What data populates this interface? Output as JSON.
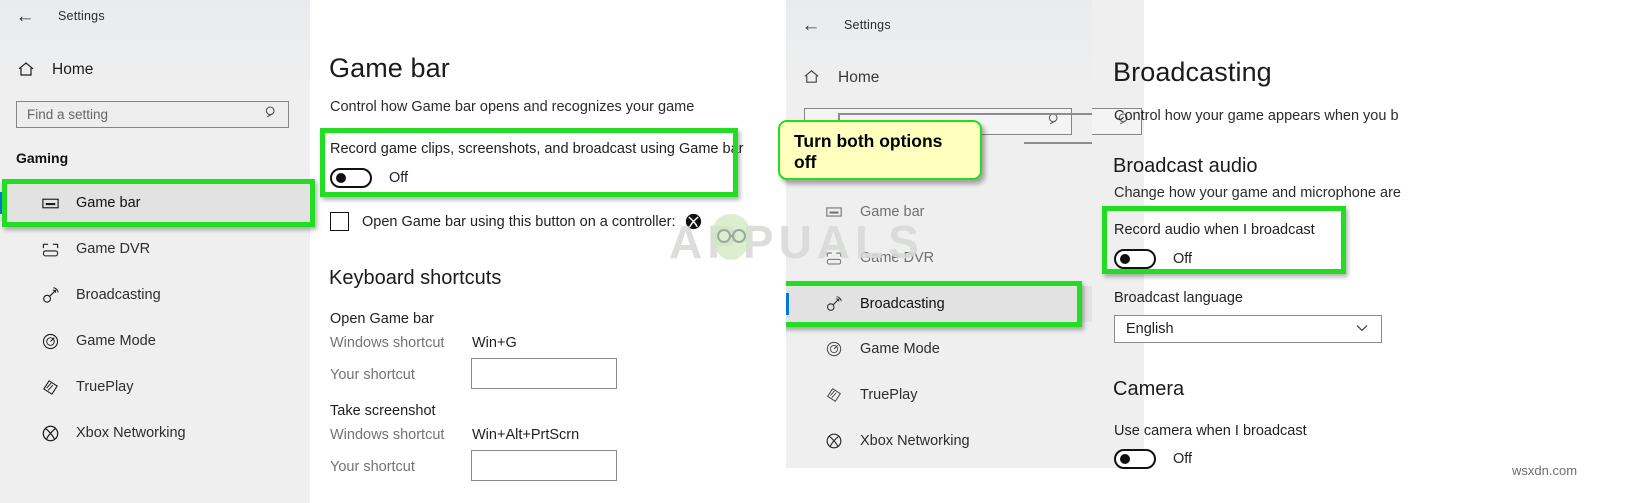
{
  "panel1": {
    "titlebar": {
      "back_icon": "back-arrow-icon",
      "title": "Settings"
    },
    "home": {
      "icon": "home-icon",
      "label": "Home"
    },
    "search": {
      "placeholder": "Find a setting",
      "icon": "search-icon"
    },
    "group_heading": "Gaming",
    "nav_items": [
      {
        "label": "Game bar",
        "icon": "game-bar-icon",
        "selected": true
      },
      {
        "label": "Game DVR",
        "icon": "game-dvr-icon",
        "selected": false
      },
      {
        "label": "Broadcasting",
        "icon": "broadcasting-icon",
        "selected": false
      },
      {
        "label": "Game Mode",
        "icon": "game-mode-icon",
        "selected": false
      },
      {
        "label": "TruePlay",
        "icon": "trueplay-icon",
        "selected": false
      },
      {
        "label": "Xbox Networking",
        "icon": "xbox-networking-icon",
        "selected": false
      }
    ],
    "page_title": "Game bar",
    "page_subtitle": "Control how Game bar opens and recognizes your game",
    "record_setting": {
      "label": "Record game clips, screenshots, and broadcast using Game bar",
      "toggle_state": "Off"
    },
    "controller_checkbox": {
      "label": "Open Game bar using this button on a controller:",
      "icon": "xbox-logo-icon",
      "checked": false
    },
    "shortcuts_heading": "Keyboard shortcuts",
    "shortcuts": [
      {
        "name": "Open Game bar",
        "windows_label": "Windows shortcut",
        "windows_value": "Win+G",
        "your_label": "Your shortcut",
        "your_value": ""
      },
      {
        "name": "Take screenshot",
        "windows_label": "Windows shortcut",
        "windows_value": "Win+Alt+PrtScrn",
        "your_label": "Your shortcut",
        "your_value": ""
      }
    ]
  },
  "panel2": {
    "titlebar": {
      "back_icon": "back-arrow-icon",
      "title": "Settings"
    },
    "home": {
      "icon": "home-icon",
      "label": "Home"
    },
    "search": {
      "placeholder": "",
      "icon": "search-icon"
    },
    "nav_items": [
      {
        "label": "Game bar",
        "icon": "game-bar-icon",
        "selected": false
      },
      {
        "label": "Game DVR",
        "icon": "game-dvr-icon",
        "selected": false
      },
      {
        "label": "Broadcasting",
        "icon": "broadcasting-icon",
        "selected": true
      },
      {
        "label": "Game Mode",
        "icon": "game-mode-icon",
        "selected": false
      },
      {
        "label": "TruePlay",
        "icon": "trueplay-icon",
        "selected": false
      },
      {
        "label": "Xbox Networking",
        "icon": "xbox-networking-icon",
        "selected": false
      }
    ],
    "callout": {
      "line1": "Turn both options",
      "line2": "off"
    }
  },
  "panel3": {
    "search": {
      "icon": "search-icon"
    },
    "page_title": "Broadcasting",
    "page_subtitle": "Control how your game appears when you b",
    "broadcast_audio": {
      "heading": "Broadcast audio",
      "subtitle": "Change how your game and microphone are",
      "setting_label": "Record audio when I broadcast",
      "toggle_state": "Off"
    },
    "broadcast_language": {
      "label": "Broadcast language",
      "value": "English",
      "chevron_icon": "chevron-down-icon"
    },
    "camera": {
      "heading": "Camera",
      "setting_label": "Use camera when I broadcast",
      "toggle_state": "Off"
    }
  },
  "watermarks": {
    "brand": "APPUALS",
    "site": "wsxdn.com"
  },
  "colors": {
    "highlight_green": "#22dd22",
    "callout_yellow": "#ffffbe",
    "selection_blue": "#0078d7",
    "sidebar_gray": "#efefef"
  }
}
